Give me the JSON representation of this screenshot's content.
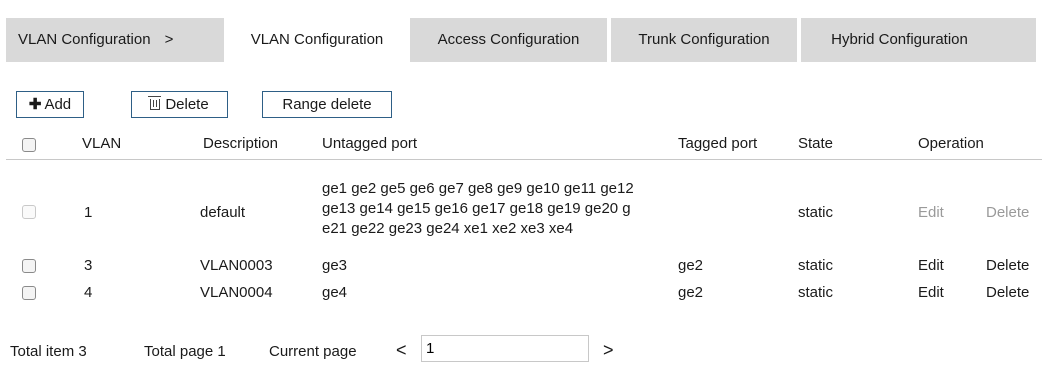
{
  "breadcrumb": {
    "root": "VLAN Configuration",
    "separator": ">"
  },
  "tabs": [
    {
      "label": "VLAN Configuration",
      "active": true
    },
    {
      "label": "Access Configuration",
      "active": false
    },
    {
      "label": "Trunk Configuration",
      "active": false
    },
    {
      "label": "Hybrid Configuration",
      "active": false
    }
  ],
  "toolbar": {
    "add_icon": "plus-icon",
    "add_label": "Add",
    "delete_icon": "trash-icon",
    "delete_label": "Delete",
    "range_delete_label": "Range delete"
  },
  "table": {
    "columns": [
      "VLAN",
      "Description",
      "Untagged port",
      "Tagged port",
      "State",
      "Operation"
    ],
    "rows": [
      {
        "vlan": "1",
        "description": "default",
        "untagged_lines": [
          "ge1 ge2 ge5 ge6 ge7 ge8 ge9 ge10 ge11 ge12",
          "ge13 ge14 ge15 ge16 ge17 ge18 ge19 ge20 g",
          "e21 ge22 ge23 ge24 xe1 xe2 xe3 xe4"
        ],
        "tagged": "",
        "state": "static",
        "edit": "Edit",
        "delete": "Delete",
        "disabled": true
      },
      {
        "vlan": "3",
        "description": "VLAN0003",
        "untagged_lines": [
          "ge3"
        ],
        "tagged": "ge2",
        "state": "static",
        "edit": "Edit",
        "delete": "Delete",
        "disabled": false
      },
      {
        "vlan": "4",
        "description": "VLAN0004",
        "untagged_lines": [
          "ge4"
        ],
        "tagged": "ge2",
        "state": "static",
        "edit": "Edit",
        "delete": "Delete",
        "disabled": false
      }
    ]
  },
  "pagination": {
    "total_item": "Total item 3",
    "total_page": "Total page 1",
    "current_page_label": "Current page",
    "prev": "<",
    "current_value": "1",
    "next": ">"
  }
}
